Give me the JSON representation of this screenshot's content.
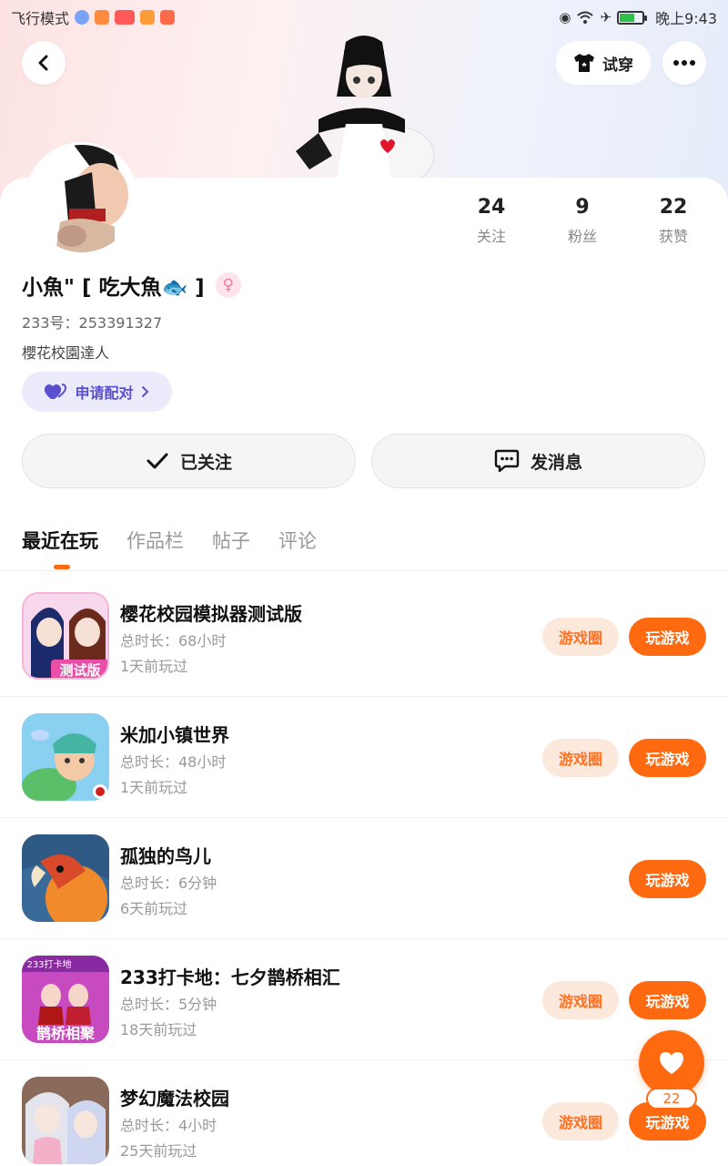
{
  "status_bar": {
    "left_text": "飞行模式",
    "time": "晚上9:43",
    "icons": [
      "eye-icon",
      "wifi-icon",
      "airplane-icon",
      "battery-icon"
    ]
  },
  "header": {
    "tryon_label": "试穿",
    "back_icon": "chevron-left-icon",
    "more_icon": "more-dots-icon"
  },
  "profile": {
    "stats": [
      {
        "value": "24",
        "label": "关注"
      },
      {
        "value": "9",
        "label": "粉丝"
      },
      {
        "value": "22",
        "label": "获赞"
      }
    ],
    "name": "小魚\" [ 吃大魚🐟 ]",
    "gender_symbol": "♀",
    "uid": "233号：253391327",
    "bio": "櫻花校園達人",
    "pair_label": "申请配对"
  },
  "actions": {
    "followed_label": "已关注",
    "message_label": "发消息"
  },
  "tabs": [
    {
      "label": "最近在玩",
      "active": true
    },
    {
      "label": "作品栏",
      "active": false
    },
    {
      "label": "帖子",
      "active": false
    },
    {
      "label": "评论",
      "active": false
    }
  ],
  "games": [
    {
      "title": "樱花校园模拟器测试版",
      "duration": "总时长：68小时",
      "last_played": "1天前玩过",
      "has_circle": true,
      "icon_text": "测试版"
    },
    {
      "title": "米加小镇世界",
      "duration": "总时长：48小时",
      "last_played": "1天前玩过",
      "has_circle": true,
      "icon_text": ""
    },
    {
      "title": "孤独的鸟儿",
      "duration": "总时长：6分钟",
      "last_played": "6天前玩过",
      "has_circle": false,
      "icon_text": ""
    },
    {
      "title": "233打卡地：七夕鹊桥相汇",
      "duration": "总时长：5分钟",
      "last_played": "18天前玩过",
      "has_circle": true,
      "icon_text": "鹊桥相聚",
      "icon_top_text": "233打卡地"
    },
    {
      "title": "梦幻魔法校园",
      "duration": "总时长：4小时",
      "last_played": "25天前玩过",
      "has_circle": true,
      "icon_text": ""
    }
  ],
  "buttons": {
    "circle_label": "游戏圈",
    "play_label": "玩游戏"
  },
  "like_fab": {
    "count": "22",
    "icon": "heart-icon"
  }
}
